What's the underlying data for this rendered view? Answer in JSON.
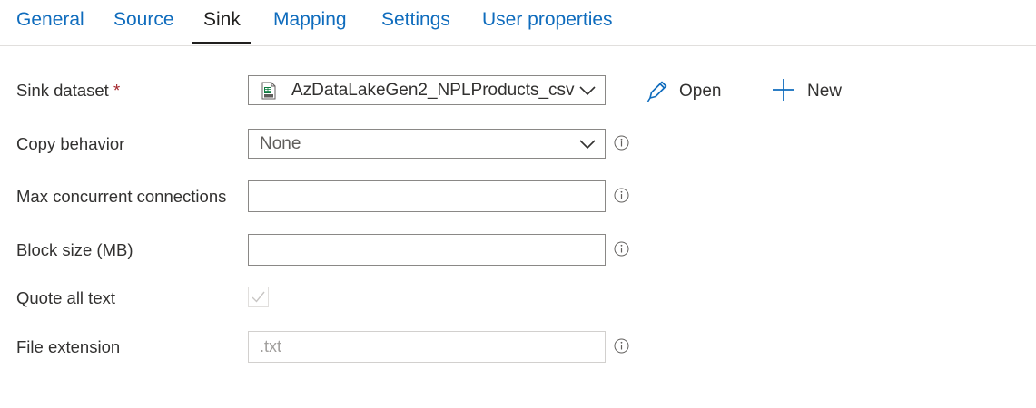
{
  "tabs": [
    {
      "label": "General"
    },
    {
      "label": "Source"
    },
    {
      "label": "Sink"
    },
    {
      "label": "Mapping"
    },
    {
      "label": "Settings"
    },
    {
      "label": "User properties"
    }
  ],
  "active_tab": "Sink",
  "sink_dataset": {
    "label": "Sink dataset",
    "required_mark": "*",
    "value": "AzDataLakeGen2_NPLProducts_csv",
    "icon": "csv-file-icon",
    "open_label": "Open",
    "new_label": "New"
  },
  "copy_behavior": {
    "label": "Copy behavior",
    "value": "None"
  },
  "max_concurrent_connections": {
    "label": "Max concurrent connections",
    "value": ""
  },
  "block_size": {
    "label": "Block size (MB)",
    "value": ""
  },
  "quote_all_text": {
    "label": "Quote all text",
    "checked": true,
    "disabled": true
  },
  "file_extension": {
    "label": "File extension",
    "placeholder": ".txt",
    "value": ""
  },
  "colors": {
    "accent": "#0f6cbd",
    "required": "#a4262c",
    "active_underline": "#201f1e"
  }
}
